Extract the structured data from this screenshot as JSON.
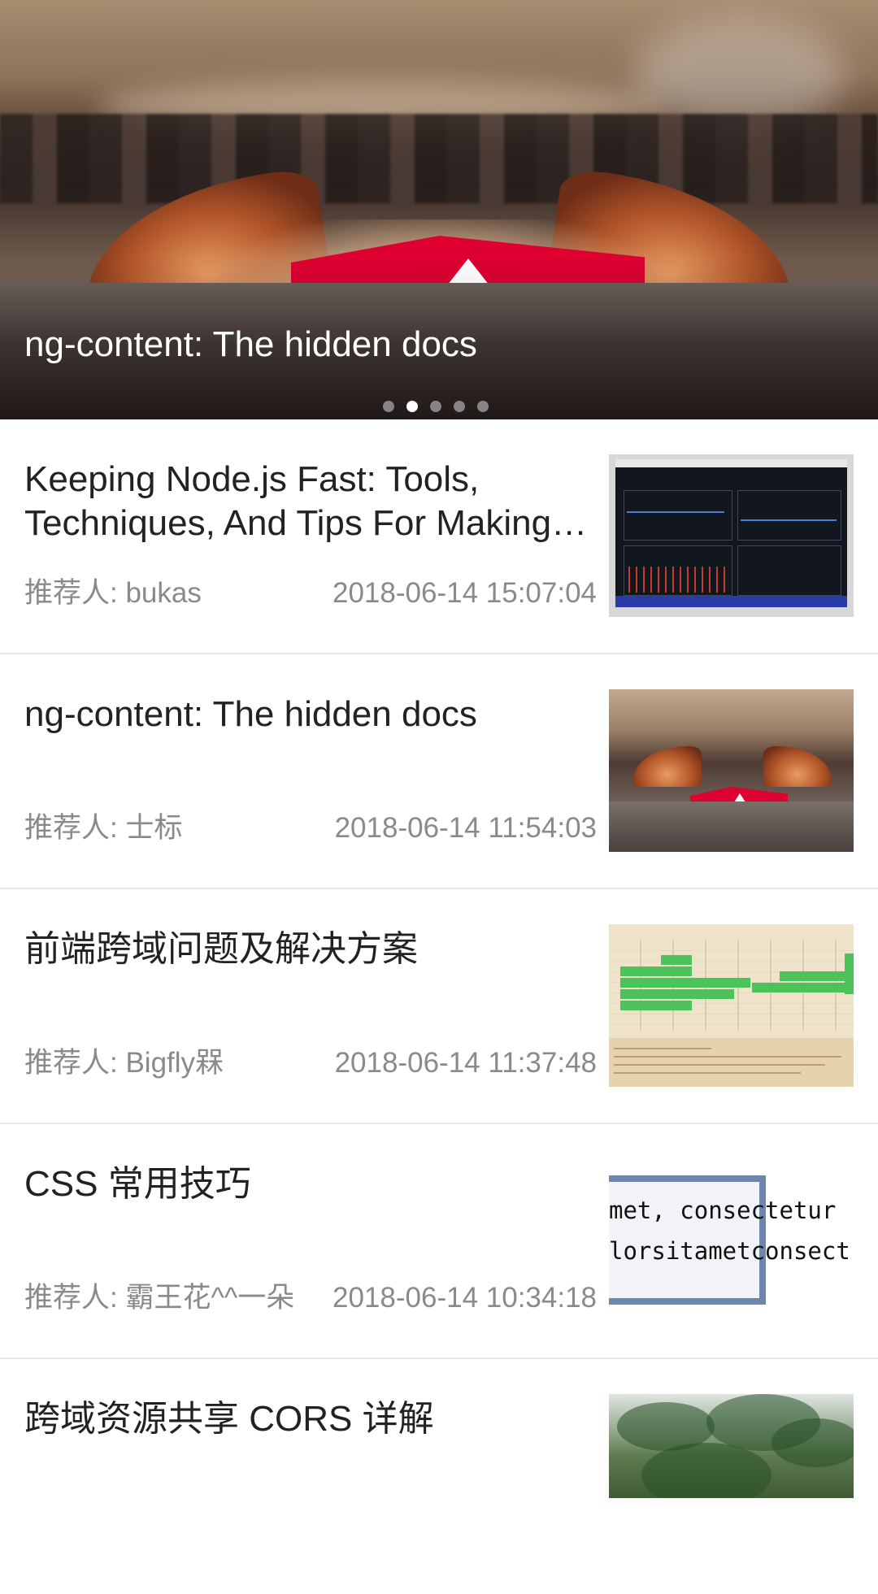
{
  "banner": {
    "title": "ng-content: The hidden docs",
    "dots_count": 5,
    "active_dot_index": 1
  },
  "articles": [
    {
      "title": "Keeping Node.js Fast: Tools, Techniques, And Tips For Making High-Performance Node.js Servers",
      "recommender": "推荐人: bukas",
      "time": "2018-06-14 15:07:04",
      "thumb": "dashboard-screenshot"
    },
    {
      "title": "ng-content: The hidden docs",
      "recommender": "推荐人: 士标",
      "time": "2018-06-14 11:54:03",
      "thumb": "cat-ears-angular-logo"
    },
    {
      "title": "前端跨域问题及解决方案",
      "recommender": "推荐人: Bigfly槑",
      "time": "2018-06-14 11:37:48",
      "thumb": "browser-compat-table"
    },
    {
      "title": "CSS 常用技巧",
      "recommender": "推荐人: 霸王花^^一朵",
      "time": "2018-06-14 10:34:18",
      "thumb": "code-box",
      "thumb_text": [
        "met, consectetur",
        "lorsitametconsect"
      ]
    },
    {
      "title": "跨域资源共享 CORS 详解",
      "recommender": "",
      "time": "",
      "thumb": "palm-trees"
    }
  ],
  "colors": {
    "angular_red": "#dd0031",
    "meta_gray": "#8a8a8a",
    "divider": "#e6e6e6"
  }
}
